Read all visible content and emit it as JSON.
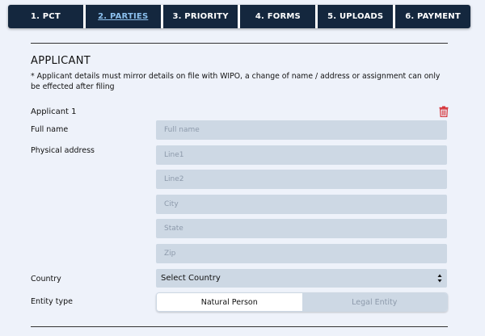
{
  "wizard": {
    "steps": [
      {
        "label": "1. PCT"
      },
      {
        "label": "2. PARTIES"
      },
      {
        "label": "3. PRIORITY"
      },
      {
        "label": "4. FORMS"
      },
      {
        "label": "5. UPLOADS"
      },
      {
        "label": "6. PAYMENT"
      }
    ],
    "active_step": "2. PARTIES"
  },
  "section": {
    "title": "APPLICANT",
    "note": "* Applicant details must mirror details on file with WIPO, a change of name / address or assignment can only be effected after filing"
  },
  "applicant": {
    "label": "Applicant 1",
    "delete_icon": "trash-icon",
    "full_name_label": "Full name",
    "full_name_placeholder": "Full name",
    "address_label": "Physical address",
    "line1_placeholder": "Line1",
    "line2_placeholder": "Line2",
    "city_placeholder": "City",
    "state_placeholder": "State",
    "zip_placeholder": "Zip",
    "country_label": "Country",
    "country_value": "Select Country",
    "entity_label": "Entity type",
    "entity_options": [
      "Natural Person",
      "Legal Entity"
    ],
    "entity_selected": "Natural Person"
  },
  "colors": {
    "nav_bg": "#14273e",
    "active_step_text": "#8cc0ee",
    "input_bg": "#cdd8e4",
    "page_bg": "#eef2fa",
    "delete_icon": "#d6363c"
  }
}
